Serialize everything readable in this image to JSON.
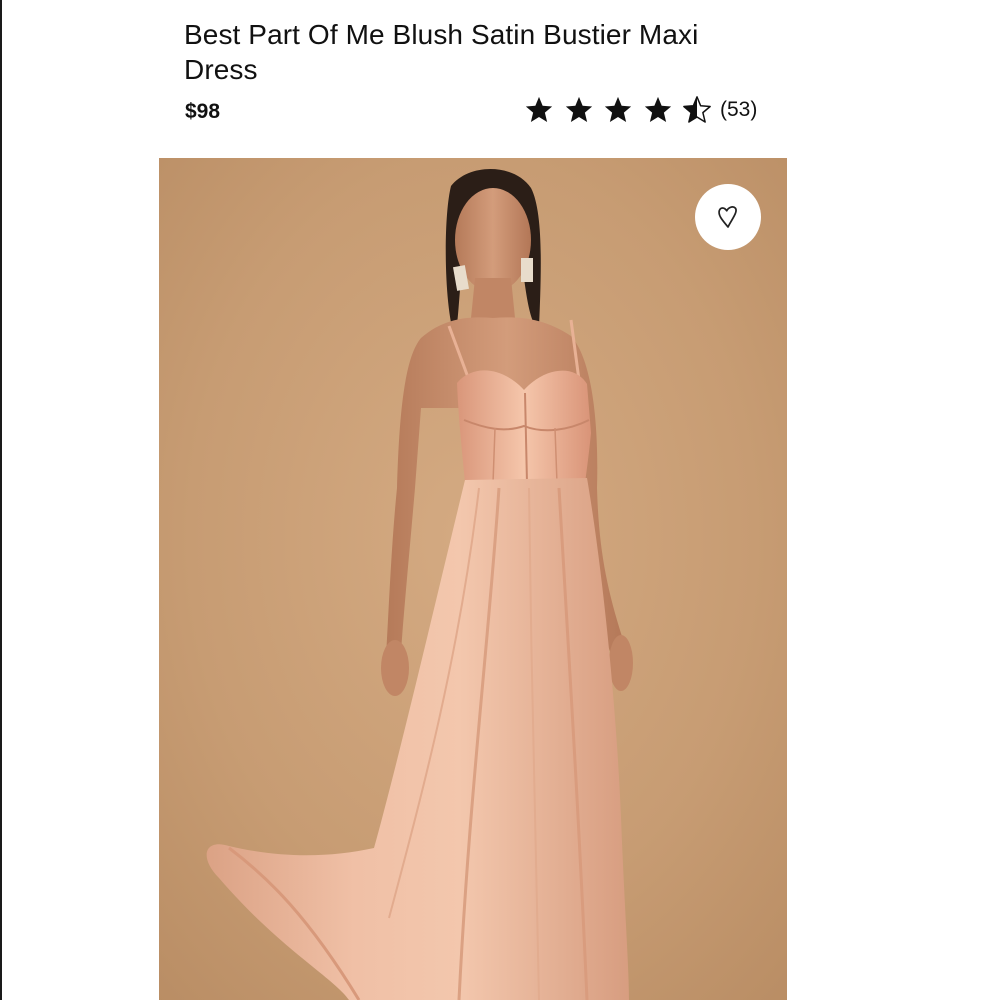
{
  "product": {
    "title": "Best Part Of Me Blush Satin Bustier Maxi Dress",
    "price": "$98",
    "rating": {
      "stars": 4.5,
      "max_stars": 5,
      "review_count": "(53)"
    }
  },
  "icons": {
    "star": "star-icon",
    "half_star": "half-star-icon",
    "wishlist": "heart-icon"
  },
  "colors": {
    "text": "#111111",
    "star": "#111111",
    "image_background": "#c99e76",
    "dress": "#eab69a"
  }
}
